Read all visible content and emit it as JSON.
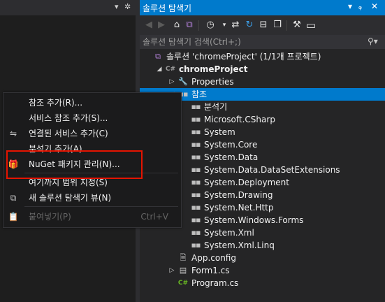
{
  "left_header": {
    "dropdown_icon": "chevron-down-icon",
    "gear_icon": "gear-icon"
  },
  "solution_explorer": {
    "title": "솔루션 탐색기",
    "title_buttons": [
      "window-position-chevron-icon",
      "pin-icon",
      "close-icon"
    ],
    "toolbar_icons": [
      "back-icon",
      "forward-icon",
      "home-icon",
      "vs-switch-views-icon",
      "history-icon",
      "sync-icon",
      "refresh-icon",
      "collapse-all-icon",
      "show-all-files-icon",
      "properties-wrench-icon",
      "preview-icon"
    ],
    "search_placeholder": "솔루션 탐색기 검색(Ctrl+;)",
    "tree": [
      {
        "label": "솔루션 'chromeProject' (1/1개 프로젝트)",
        "icon": "solution-icon",
        "level": 0,
        "bold": false,
        "expander": ""
      },
      {
        "label": "chromeProject",
        "icon": "csharp-project-icon",
        "level": 1,
        "bold": true,
        "expander": "◢"
      },
      {
        "label": "Properties",
        "icon": "wrench-icon",
        "level": 2,
        "bold": false,
        "expander": "▷"
      },
      {
        "label": "참조",
        "icon": "references-icon",
        "level": 2,
        "bold": false,
        "expander": "◢",
        "selected": true
      },
      {
        "label": "분석기",
        "icon": "analyzer-icon",
        "level": 3,
        "bold": false,
        "expander": ""
      },
      {
        "label": "Microsoft.CSharp",
        "icon": "reference-icon",
        "level": 3,
        "bold": false,
        "expander": ""
      },
      {
        "label": "System",
        "icon": "reference-icon",
        "level": 3,
        "bold": false,
        "expander": ""
      },
      {
        "label": "System.Core",
        "icon": "reference-icon",
        "level": 3,
        "bold": false,
        "expander": ""
      },
      {
        "label": "System.Data",
        "icon": "reference-icon",
        "level": 3,
        "bold": false,
        "expander": ""
      },
      {
        "label": "System.Data.DataSetExtensions",
        "icon": "reference-icon",
        "level": 3,
        "bold": false,
        "expander": ""
      },
      {
        "label": "System.Deployment",
        "icon": "reference-icon",
        "level": 3,
        "bold": false,
        "expander": ""
      },
      {
        "label": "System.Drawing",
        "icon": "reference-icon",
        "level": 3,
        "bold": false,
        "expander": ""
      },
      {
        "label": "System.Net.Http",
        "icon": "reference-icon",
        "level": 3,
        "bold": false,
        "expander": ""
      },
      {
        "label": "System.Windows.Forms",
        "icon": "reference-icon",
        "level": 3,
        "bold": false,
        "expander": ""
      },
      {
        "label": "System.Xml",
        "icon": "reference-icon",
        "level": 3,
        "bold": false,
        "expander": ""
      },
      {
        "label": "System.Xml.Linq",
        "icon": "reference-icon",
        "level": 3,
        "bold": false,
        "expander": ""
      },
      {
        "label": "App.config",
        "icon": "config-file-icon",
        "level": 2,
        "bold": false,
        "expander": ""
      },
      {
        "label": "Form1.cs",
        "icon": "form-icon",
        "level": 2,
        "bold": false,
        "expander": "▷"
      },
      {
        "label": "Program.cs",
        "icon": "csharp-file-icon",
        "level": 2,
        "bold": false,
        "expander": ""
      }
    ]
  },
  "context_menu": {
    "items": [
      {
        "label": "참조 추가(R)...",
        "icon": "",
        "shortcut": "",
        "disabled": false
      },
      {
        "label": "서비스 참조 추가(S)...",
        "icon": "",
        "shortcut": "",
        "disabled": false
      },
      {
        "label": "연결된 서비스 추가(C)",
        "icon": "connected-service-icon",
        "shortcut": "",
        "disabled": false
      },
      {
        "label": "분석기 추가(A)...",
        "icon": "",
        "shortcut": "",
        "disabled": false
      },
      {
        "label": "NuGet 패키지 관리(N)...",
        "icon": "nuget-package-icon",
        "shortcut": "",
        "disabled": false
      },
      {
        "label": "여기까지 범위 지정(S)",
        "icon": "",
        "shortcut": "",
        "disabled": false
      },
      {
        "label": "새 솔루션 탐색기 뷰(N)",
        "icon": "new-explorer-view-icon",
        "shortcut": "",
        "disabled": false
      },
      {
        "label": "붙여넣기(P)",
        "icon": "paste-icon",
        "shortcut": "Ctrl+V",
        "disabled": true
      }
    ]
  },
  "colors": {
    "accent": "#007acc",
    "highlight_box": "#e51400",
    "background": "#1e1e1e",
    "panel": "#252526"
  }
}
